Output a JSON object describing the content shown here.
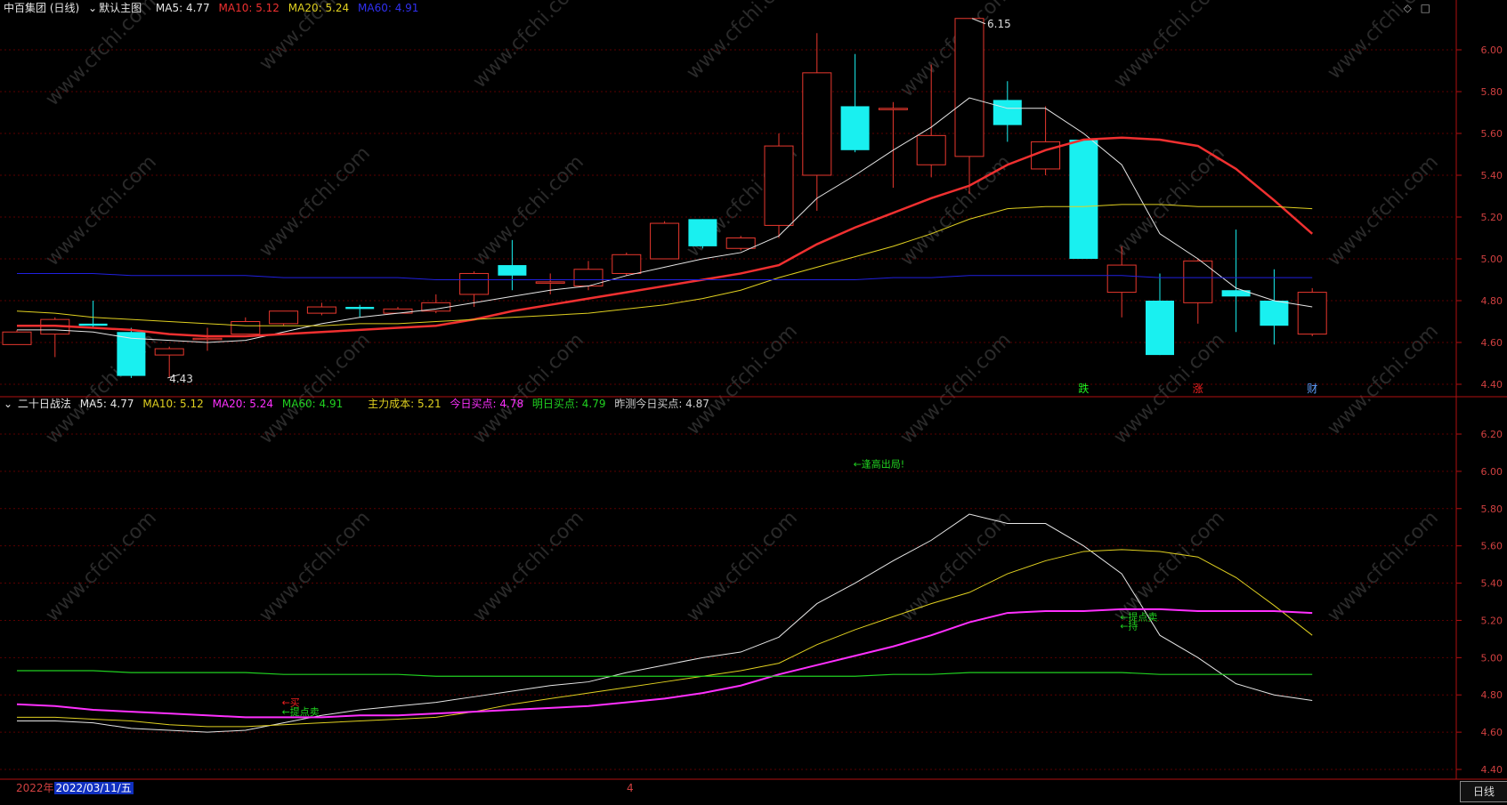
{
  "header_main": {
    "stock": "中百集团 (日线)",
    "template": "默认主图",
    "ma5": "MA5: 4.77",
    "ma10": "MA10: 5.12",
    "ma20": "MA20: 5.24",
    "ma60": "MA60: 4.91"
  },
  "header_sub": {
    "name": "二十日战法",
    "ma5": "MA5: 4.77",
    "ma10": "MA10: 5.12",
    "ma20": "MA20: 5.24",
    "ma60": "MA60: 4.91",
    "cost": "主力成本: 5.21",
    "today_buy": "今日买点: 4.78",
    "tomorrow_buy": "明日买点: 4.79",
    "yest_pred": "昨测今日买点: 4.87"
  },
  "footer": {
    "year": "2022年",
    "date": "2022/03/11/五",
    "marker": "4",
    "period_button": "日线"
  },
  "toolbar": {
    "diamond": "◇",
    "square": "□"
  },
  "watermark": "www.cfchi.com",
  "colors": {
    "up": "#e8382e",
    "down": "#19f0f0",
    "ma5": "#e6e6e6",
    "ma10": "#f03030",
    "ma20": "#e0d020",
    "ma60": "#2020e0",
    "sub_ma10": "#e0d020",
    "sub_ma20": "#ff30ff",
    "sub_ma60": "#20d020",
    "grid": "#5a0000",
    "axis_text": "#d04040"
  },
  "chart_data": [
    {
      "type": "candlestick",
      "title": "中百集团 (日线)",
      "ylim": [
        4.4,
        6.2
      ],
      "yticks": [
        "6.00",
        "5.80",
        "5.60",
        "5.40",
        "5.20",
        "5.00",
        "4.80",
        "4.60",
        "4.40"
      ],
      "ytick_values": [
        6.0,
        5.8,
        5.6,
        5.4,
        5.2,
        5.0,
        4.8,
        4.6,
        4.4
      ],
      "candles": [
        {
          "o": 4.59,
          "h": 4.66,
          "l": 4.59,
          "c": 4.65
        },
        {
          "o": 4.64,
          "h": 4.72,
          "l": 4.53,
          "c": 4.71
        },
        {
          "o": 4.69,
          "h": 4.8,
          "l": 4.67,
          "c": 4.68
        },
        {
          "o": 4.65,
          "h": 4.67,
          "l": 4.43,
          "c": 4.44
        },
        {
          "o": 4.54,
          "h": 4.58,
          "l": 4.43,
          "c": 4.57
        },
        {
          "o": 4.62,
          "h": 4.67,
          "l": 4.56,
          "c": 4.62
        },
        {
          "o": 4.64,
          "h": 4.72,
          "l": 4.64,
          "c": 4.7
        },
        {
          "o": 4.69,
          "h": 4.75,
          "l": 4.68,
          "c": 4.75
        },
        {
          "o": 4.74,
          "h": 4.79,
          "l": 4.73,
          "c": 4.77
        },
        {
          "o": 4.77,
          "h": 4.78,
          "l": 4.72,
          "c": 4.76
        },
        {
          "o": 4.74,
          "h": 4.77,
          "l": 4.74,
          "c": 4.76
        },
        {
          "o": 4.75,
          "h": 4.83,
          "l": 4.74,
          "c": 4.79
        },
        {
          "o": 4.83,
          "h": 4.94,
          "l": 4.77,
          "c": 4.93
        },
        {
          "o": 4.97,
          "h": 5.09,
          "l": 4.85,
          "c": 4.92
        },
        {
          "o": 4.89,
          "h": 4.93,
          "l": 4.83,
          "c": 4.89
        },
        {
          "o": 4.87,
          "h": 4.99,
          "l": 4.85,
          "c": 4.95
        },
        {
          "o": 4.93,
          "h": 5.03,
          "l": 4.92,
          "c": 5.02
        },
        {
          "o": 5.0,
          "h": 5.18,
          "l": 5.0,
          "c": 5.17
        },
        {
          "o": 5.19,
          "h": 5.19,
          "l": 5.05,
          "c": 5.06
        },
        {
          "o": 5.05,
          "h": 5.11,
          "l": 5.04,
          "c": 5.1
        },
        {
          "o": 5.16,
          "h": 5.6,
          "l": 5.1,
          "c": 5.54
        },
        {
          "o": 5.4,
          "h": 6.08,
          "l": 5.23,
          "c": 5.89
        },
        {
          "o": 5.73,
          "h": 5.98,
          "l": 5.51,
          "c": 5.52
        },
        {
          "o": 5.72,
          "h": 5.75,
          "l": 5.34,
          "c": 5.72
        },
        {
          "o": 5.45,
          "h": 5.93,
          "l": 5.39,
          "c": 5.59
        },
        {
          "o": 5.49,
          "h": 6.15,
          "l": 5.31,
          "c": 6.15
        },
        {
          "o": 5.76,
          "h": 5.85,
          "l": 5.56,
          "c": 5.64
        },
        {
          "o": 5.43,
          "h": 5.73,
          "l": 5.4,
          "c": 5.56
        },
        {
          "o": 5.57,
          "h": 5.57,
          "l": 5.0,
          "c": 5.0
        },
        {
          "o": 4.84,
          "h": 5.06,
          "l": 4.72,
          "c": 4.97
        },
        {
          "o": 4.8,
          "h": 4.93,
          "l": 4.54,
          "c": 4.54
        },
        {
          "o": 4.79,
          "h": 5.0,
          "l": 4.69,
          "c": 4.99
        },
        {
          "o": 4.85,
          "h": 5.14,
          "l": 4.65,
          "c": 4.82
        },
        {
          "o": 4.8,
          "h": 4.95,
          "l": 4.59,
          "c": 4.68
        },
        {
          "o": 4.64,
          "h": 4.86,
          "l": 4.63,
          "c": 4.84
        }
      ],
      "series": [
        {
          "name": "MA5",
          "values": [
            4.66,
            4.66,
            4.65,
            4.62,
            4.61,
            4.6,
            4.61,
            4.65,
            4.69,
            4.72,
            4.74,
            4.76,
            4.79,
            4.82,
            4.85,
            4.87,
            4.92,
            4.96,
            5.0,
            5.03,
            5.11,
            5.29,
            5.4,
            5.52,
            5.63,
            5.77,
            5.72,
            5.72,
            5.6,
            5.45,
            5.12,
            5.0,
            4.86,
            4.8,
            4.77
          ]
        },
        {
          "name": "MA10",
          "values": [
            4.68,
            4.68,
            4.67,
            4.66,
            4.64,
            4.63,
            4.63,
            4.64,
            4.65,
            4.66,
            4.67,
            4.68,
            4.71,
            4.75,
            4.78,
            4.81,
            4.84,
            4.87,
            4.9,
            4.93,
            4.97,
            5.07,
            5.15,
            5.22,
            5.29,
            5.35,
            5.45,
            5.52,
            5.57,
            5.58,
            5.57,
            5.54,
            5.43,
            5.28,
            5.12
          ]
        },
        {
          "name": "MA20",
          "values": [
            4.75,
            4.74,
            4.72,
            4.71,
            4.7,
            4.69,
            4.68,
            4.68,
            4.68,
            4.69,
            4.69,
            4.7,
            4.71,
            4.72,
            4.73,
            4.74,
            4.76,
            4.78,
            4.81,
            4.85,
            4.91,
            4.96,
            5.01,
            5.06,
            5.12,
            5.19,
            5.24,
            5.25,
            5.25,
            5.26,
            5.26,
            5.25,
            5.25,
            5.25,
            5.24
          ]
        },
        {
          "name": "MA60",
          "values": [
            4.93,
            4.93,
            4.93,
            4.92,
            4.92,
            4.92,
            4.92,
            4.91,
            4.91,
            4.91,
            4.91,
            4.9,
            4.9,
            4.9,
            4.9,
            4.9,
            4.9,
            4.9,
            4.9,
            4.9,
            4.9,
            4.9,
            4.9,
            4.91,
            4.91,
            4.92,
            4.92,
            4.92,
            4.92,
            4.92,
            4.91,
            4.91,
            4.91,
            4.91,
            4.91
          ]
        }
      ],
      "annotations": [
        {
          "text": "6.15",
          "index": 25,
          "price": 6.15
        },
        {
          "text": "4.43",
          "index": 4,
          "price": 4.43
        },
        {
          "text": "跌",
          "index": 28,
          "color": "#20f020"
        },
        {
          "text": "涨",
          "index": 31,
          "color": "#f02020"
        },
        {
          "text": "财",
          "index": 34,
          "color": "#60a0ff"
        }
      ]
    },
    {
      "type": "line",
      "title": "二十日战法",
      "ylim": [
        4.4,
        6.3
      ],
      "yticks": [
        "6.20",
        "6.00",
        "5.80",
        "5.60",
        "5.40",
        "5.20",
        "5.00",
        "4.80",
        "4.60",
        "4.40"
      ],
      "ytick_values": [
        6.2,
        6.0,
        5.8,
        5.6,
        5.4,
        5.2,
        5.0,
        4.8,
        4.6,
        4.4
      ],
      "series": [
        {
          "name": "MA5",
          "values": [
            4.66,
            4.66,
            4.65,
            4.62,
            4.61,
            4.6,
            4.61,
            4.65,
            4.69,
            4.72,
            4.74,
            4.76,
            4.79,
            4.82,
            4.85,
            4.87,
            4.92,
            4.96,
            5.0,
            5.03,
            5.11,
            5.29,
            5.4,
            5.52,
            5.63,
            5.77,
            5.72,
            5.72,
            5.6,
            5.45,
            5.12,
            5.0,
            4.86,
            4.8,
            4.77
          ]
        },
        {
          "name": "MA10",
          "values": [
            4.68,
            4.68,
            4.67,
            4.66,
            4.64,
            4.63,
            4.63,
            4.64,
            4.65,
            4.66,
            4.67,
            4.68,
            4.71,
            4.75,
            4.78,
            4.81,
            4.84,
            4.87,
            4.9,
            4.93,
            4.97,
            5.07,
            5.15,
            5.22,
            5.29,
            5.35,
            5.45,
            5.52,
            5.57,
            5.58,
            5.57,
            5.54,
            5.43,
            5.28,
            5.12
          ]
        },
        {
          "name": "MA20",
          "values": [
            4.75,
            4.74,
            4.72,
            4.71,
            4.7,
            4.69,
            4.68,
            4.68,
            4.68,
            4.69,
            4.69,
            4.7,
            4.71,
            4.72,
            4.73,
            4.74,
            4.76,
            4.78,
            4.81,
            4.85,
            4.91,
            4.96,
            5.01,
            5.06,
            5.12,
            5.19,
            5.24,
            5.25,
            5.25,
            5.26,
            5.26,
            5.25,
            5.25,
            5.25,
            5.24
          ]
        },
        {
          "name": "MA60",
          "values": [
            4.93,
            4.93,
            4.93,
            4.92,
            4.92,
            4.92,
            4.92,
            4.91,
            4.91,
            4.91,
            4.91,
            4.9,
            4.9,
            4.9,
            4.9,
            4.9,
            4.9,
            4.9,
            4.9,
            4.9,
            4.9,
            4.9,
            4.9,
            4.91,
            4.91,
            4.92,
            4.92,
            4.92,
            4.92,
            4.92,
            4.91,
            4.91,
            4.91,
            4.91,
            4.91
          ]
        }
      ],
      "annotations": [
        {
          "text": "←逢高出局!",
          "index": 22,
          "price": 6.04,
          "color": "#20d020"
        },
        {
          "text": "←买",
          "index": 7,
          "price": 4.76,
          "color": "#f02020"
        },
        {
          "text": "←提点卖",
          "index": 7,
          "price": 4.71,
          "color": "#20d020"
        },
        {
          "text": "←提点卖",
          "index": 29,
          "price": 5.22,
          "color": "#20d020"
        },
        {
          "text": "←持",
          "index": 29,
          "price": 5.17,
          "color": "#20d020"
        }
      ]
    }
  ]
}
